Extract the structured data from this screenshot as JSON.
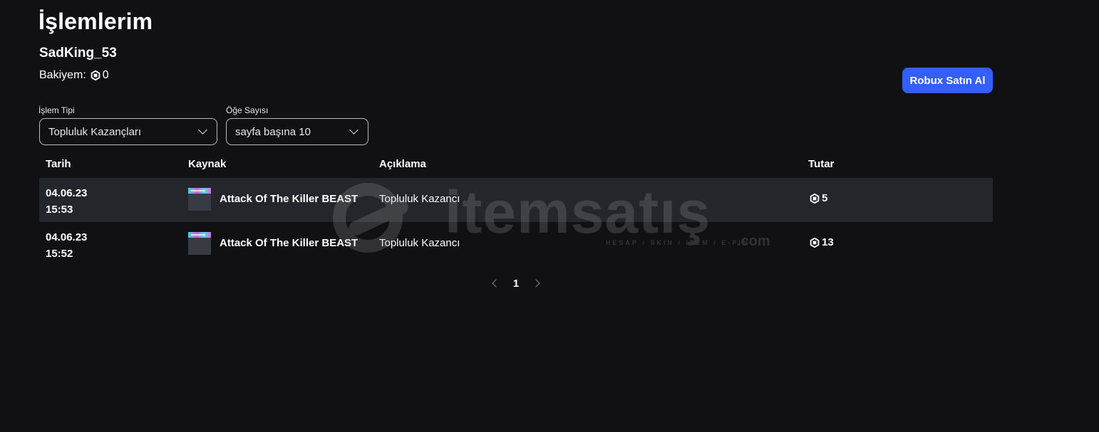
{
  "page": {
    "title": "İşlemlerim",
    "username": "SadKing_53",
    "balance_label": "Bakiyem:",
    "balance_value": "0",
    "buy_button": "Robux Satın Al",
    "accent_color": "#335fff"
  },
  "filters": {
    "type_label": "İşlem Tipi",
    "type_value": "Topluluk Kazançları",
    "count_label": "Öğe Sayısı",
    "count_value": "sayfa başına 10"
  },
  "table": {
    "headers": {
      "date": "Tarih",
      "source": "Kaynak",
      "description": "Açıklama",
      "amount": "Tutar"
    },
    "rows": [
      {
        "date": "04.06.23",
        "time": "15:53",
        "source": "Attack Of The Killer BEAST",
        "description": "Topluluk Kazancı",
        "amount": "5"
      },
      {
        "date": "04.06.23",
        "time": "15:52",
        "source": "Attack Of The Killer BEAST",
        "description": "Topluluk Kazancı",
        "amount": "13"
      }
    ]
  },
  "pagination": {
    "current_page": "1"
  },
  "watermark": {
    "brand": "itemsatış",
    "tagline": "HESAP / SKIN / ITEM / E-PIN",
    "suffix": ".com"
  },
  "icons": {
    "currency": "robux-icon",
    "dropdown": "chevron-down-icon",
    "prev": "chevron-left-icon",
    "next": "chevron-right-icon"
  }
}
